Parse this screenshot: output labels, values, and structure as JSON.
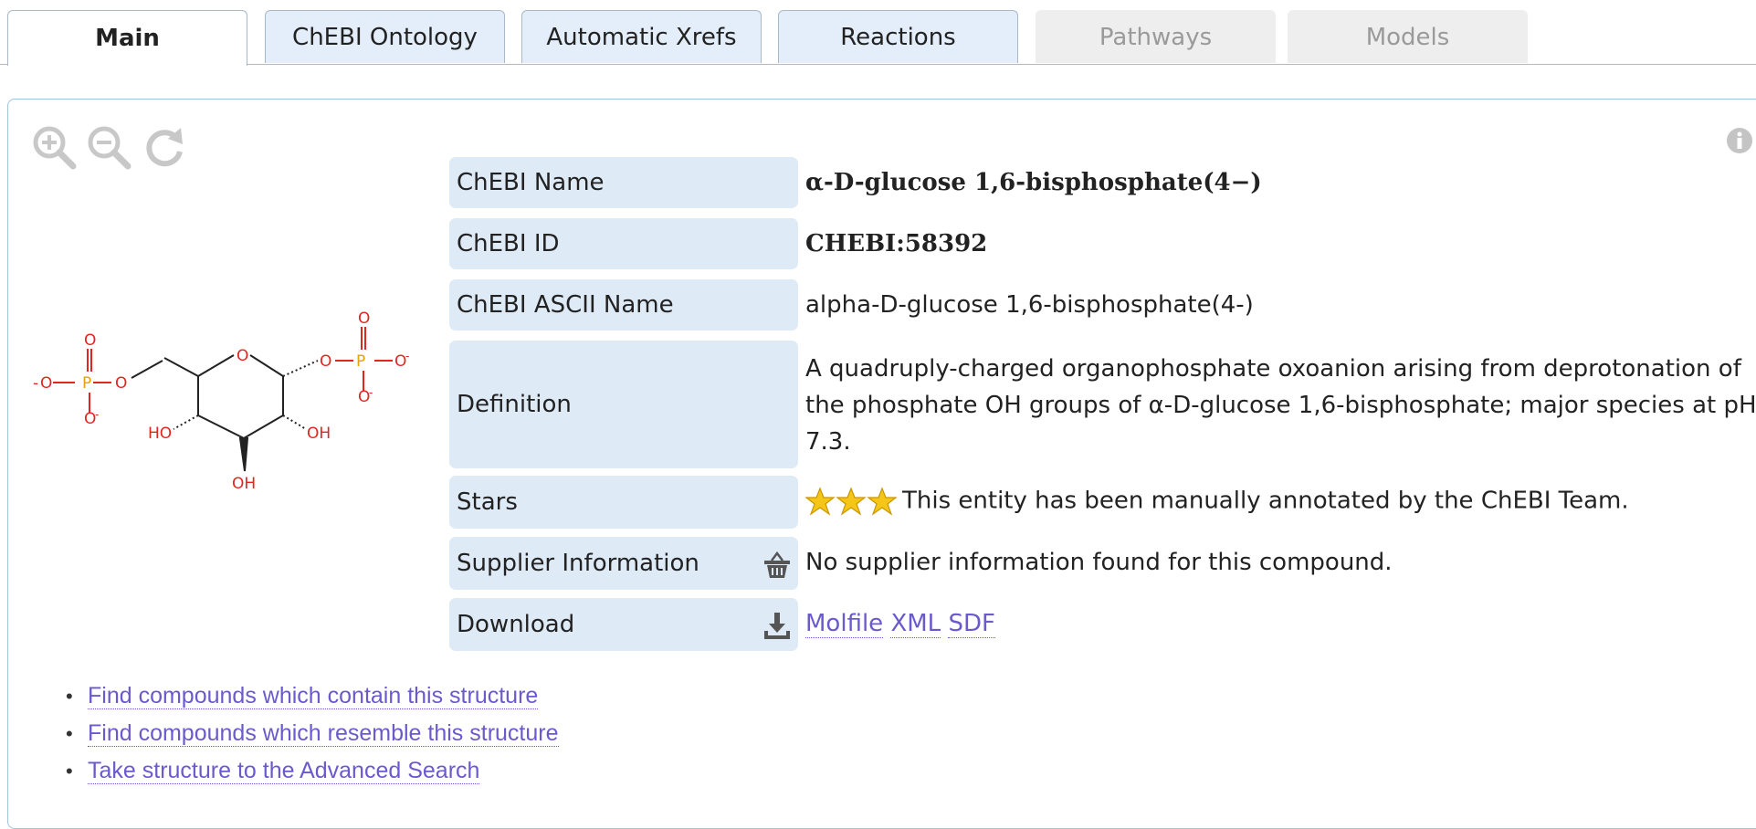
{
  "tabs": [
    {
      "label": "Main",
      "state": "active"
    },
    {
      "label": "ChEBI Ontology",
      "state": "normal"
    },
    {
      "label": "Automatic Xrefs",
      "state": "normal"
    },
    {
      "label": "Reactions",
      "state": "normal"
    },
    {
      "label": "Pathways",
      "state": "disabled"
    },
    {
      "label": "Models",
      "state": "disabled"
    }
  ],
  "viewer": {
    "tools": [
      "zoom-in-icon",
      "zoom-out-icon",
      "reset-rotate-icon"
    ],
    "info_icon": "info-icon"
  },
  "structure": {
    "atoms": [
      "O",
      "O",
      "O",
      "P",
      "O",
      "O",
      "O",
      "O",
      "O",
      "P",
      "O",
      "O",
      "O",
      "HO",
      "OH",
      "OH"
    ],
    "charges": [
      "-",
      "-",
      "-",
      "-"
    ]
  },
  "properties": {
    "name": {
      "label": "ChEBI Name",
      "value": "α-D-glucose 1,6-bisphosphate(4−)"
    },
    "id": {
      "label": "ChEBI ID",
      "value": "CHEBI:58392"
    },
    "ascii": {
      "label": "ChEBI ASCII Name",
      "value": "alpha-D-glucose 1,6-bisphosphate(4-)"
    },
    "definition": {
      "label": "Definition",
      "value": "A quadruply-charged organophosphate oxoanion arising from deprotonation of the phosphate OH groups of α-D-glucose 1,6-bisphosphate; major species at pH 7.3."
    },
    "stars": {
      "label": "Stars",
      "count": 3,
      "value": "This entity has been manually annotated by the ChEBI Team."
    },
    "supplier": {
      "label": "Supplier Information",
      "icon": "basket-icon",
      "value": "No supplier information found for this compound."
    },
    "download": {
      "label": "Download",
      "icon": "download-icon",
      "links": [
        "Molfile",
        "XML",
        "SDF"
      ]
    }
  },
  "structure_links": [
    "Find compounds which contain this structure",
    "Find compounds which resemble this structure",
    "Take structure to the Advanced Search"
  ],
  "colors": {
    "tab_bg": "#e3eefa",
    "label_bg": "#deeaf6",
    "link": "#6a5acd",
    "panel_border": "#9fc6db",
    "oxygen": "#e0261f",
    "phosphorus": "#e8a200"
  }
}
